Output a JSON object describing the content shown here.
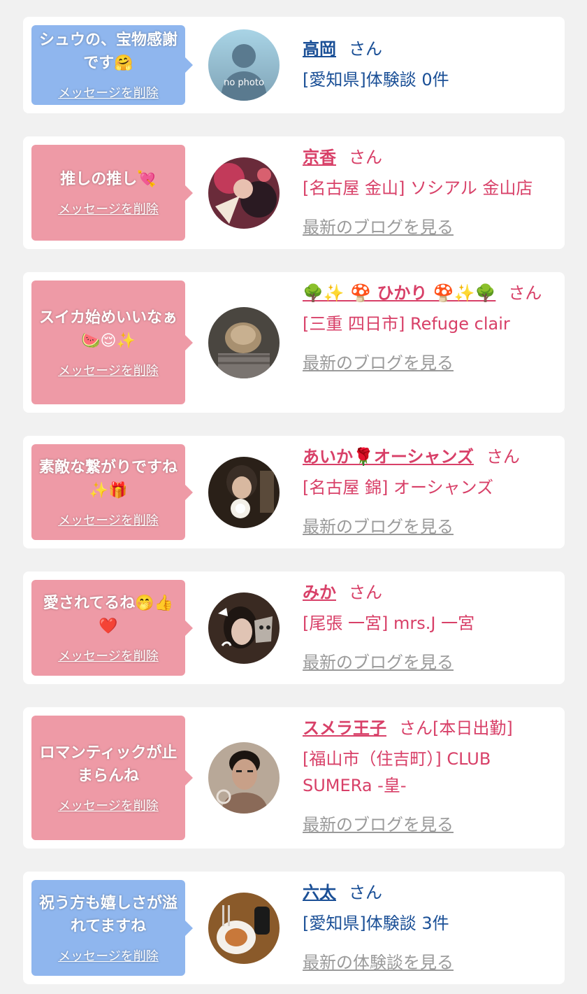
{
  "theme": {
    "pink_text": "#d84068",
    "blue_text": "#1a4f96",
    "pink_bubble": "#ee9aa6",
    "blue_bubble": "#8fb6ee",
    "link_gray": "#9a9a9a"
  },
  "delete_label": "メッセージを削除",
  "entries": [
    {
      "message": "シュウの、宝物感謝です",
      "message_emoji": "🤗",
      "name": "高岡",
      "suffix": "さん",
      "detail": "[愛知県]体験談 0件",
      "link": "",
      "avatar_text": "no photo"
    },
    {
      "message": "推しの推し",
      "message_emoji": "💘",
      "name": "京香",
      "suffix": "さん",
      "detail": "[名古屋 金山] ソシアル 金山店",
      "link": "最新のブログを見る"
    },
    {
      "message": "スイカ始めいいなぁ",
      "message_emoji": "🍉😌✨",
      "name": "🌳✨ 🍄 ひかり 🍄✨🌳",
      "suffix": "さん",
      "detail": "[三重 四日市] Refuge clair",
      "link": "最新のブログを見る"
    },
    {
      "message": "素敵な繋がりですね",
      "message_emoji": "✨🎁",
      "name": "あいか🌹オーシャンズ",
      "suffix": "さん",
      "detail": "[名古屋 錦] オーシャンズ",
      "link": "最新のブログを見る"
    },
    {
      "message": "愛されてるね",
      "message_emoji": "🤭👍❤️",
      "name": "みか",
      "suffix": "さん",
      "detail": "[尾張 一宮] mrs.J 一宮",
      "link": "最新のブログを見る"
    },
    {
      "message": "ロマンティックが止まらんね",
      "message_emoji": "",
      "name": "スメラ王子",
      "suffix": "さん[本日出勤]",
      "detail": "[福山市（住吉町）] CLUB SUMERa -皇-",
      "link": "最新のブログを見る"
    },
    {
      "message": "祝う方も嬉しさが溢れてますね",
      "message_emoji": "",
      "name": "六太",
      "suffix": "さん",
      "detail": "[愛知県]体験談 3件",
      "link": "最新の体験談を見る"
    }
  ]
}
